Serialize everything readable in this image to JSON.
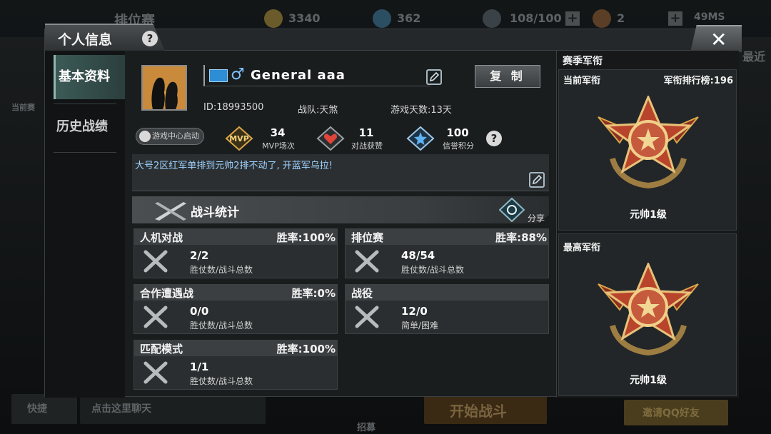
{
  "background": {
    "top_title": "排位赛",
    "gold": "3340",
    "diamonds": "362",
    "energy": "108/100",
    "tickets": "2",
    "signal": "49MS",
    "left_partial": "当前赛",
    "right_partial": "最近",
    "bottom_quick": "快捷",
    "bottom_chat_placeholder": "点击这里聊天",
    "bottom_start": "开始战斗",
    "bottom_invite": "邀请QQ好友",
    "bottom_recruit": "招募"
  },
  "modal": {
    "title": "个人信息",
    "help": "?",
    "close": "✕"
  },
  "nav": {
    "items": [
      {
        "label": "基本资料",
        "active": true
      },
      {
        "label": "历史战绩",
        "active": false
      }
    ]
  },
  "profile": {
    "gender_symbol": "♂",
    "name": "General aaa",
    "copy_label": "复 制",
    "id_text": "ID:18993500",
    "team_text": "战队:天煞",
    "days_text": "游戏天数:13天",
    "game_center": "游戏中心启动",
    "signature": "大号2区红军单排到元帅2排不动了, 开蓝军乌拉!"
  },
  "badges": [
    {
      "icon": "mvp-icon",
      "icon_text": "MVP",
      "value": "34",
      "label": "MVP场次"
    },
    {
      "icon": "heart-icon",
      "value": "11",
      "label": "对战获赞"
    },
    {
      "icon": "star-icon",
      "value": "100",
      "label": "信誉积分"
    }
  ],
  "combat": {
    "title": "战斗统计",
    "share": "分享",
    "cards": [
      {
        "name": "人机对战",
        "rate": "胜率:100%",
        "value": "2/2",
        "sub": "胜仗数/战斗总数"
      },
      {
        "name": "排位赛",
        "rate": "胜率:88%",
        "value": "48/54",
        "sub": "胜仗数/战斗总数"
      },
      {
        "name": "合作遭遇战",
        "rate": "胜率:0%",
        "value": "0/0",
        "sub": "胜仗数/战斗总数"
      },
      {
        "name": "战役",
        "rate": "",
        "value": "12/0",
        "sub": "简单/困难"
      },
      {
        "name": "匹配模式",
        "rate": "胜率:100%",
        "value": "1/1",
        "sub": "胜仗数/战斗总数"
      }
    ]
  },
  "rank": {
    "title": "赛季军衔",
    "current_label": "当前军衔",
    "leaderboard": "军衔排行榜:196",
    "current_rank": "元帅1级",
    "highest_label": "最高军衔",
    "highest_rank": "元帅1级"
  },
  "colors": {
    "accent_teal": "#3c5a57",
    "name_blue": "#9fd2ff",
    "medal_red": "#b8442b",
    "medal_gold": "#d8a64a"
  }
}
